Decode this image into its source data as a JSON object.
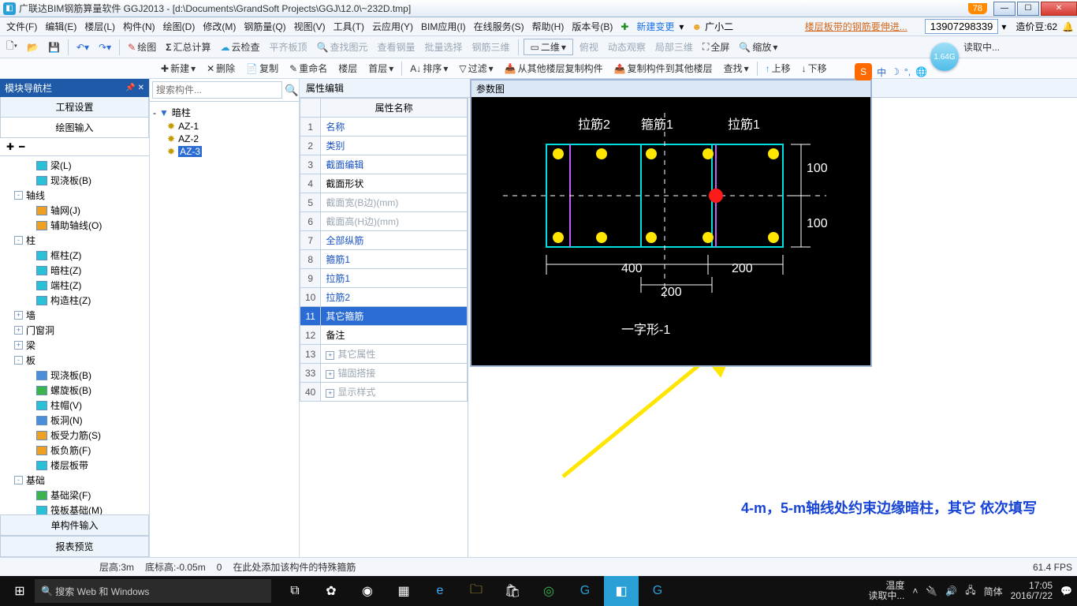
{
  "title": "广联达BIM钢筋算量软件 GGJ2013 - [d:\\Documents\\GrandSoft Projects\\GGJ\\12.0\\~232D.tmp]",
  "badge": "78",
  "menubar": [
    "文件(F)",
    "编辑(E)",
    "楼层(L)",
    "构件(N)",
    "绘图(D)",
    "修改(M)",
    "钢筋量(Q)",
    "视图(V)",
    "工具(T)",
    "云应用(Y)",
    "BIM应用(I)",
    "在线服务(S)",
    "帮助(H)",
    "版本号(B)"
  ],
  "new_change": "新建变更",
  "user_label": "广小二",
  "news": "楼层板带的钢筋要伸进...",
  "phone": "13907298339",
  "coin_label": "造价豆:62",
  "toolbar1": {
    "draw": "绘图",
    "sum": "汇总计算",
    "cloud": "云检查",
    "flat": "平齐板顶",
    "findg": "查找图元",
    "steel": "查看钢量",
    "batch": "批量选择",
    "rebar3d": "钢筋三维",
    "view2d": "二维",
    "pview": "俯视",
    "dyn": "动态观察",
    "part3d": "局部三维",
    "full": "全屏",
    "zoom": "缩放",
    "read": "读取中..."
  },
  "gbubble": "1.64G",
  "toolbar2": {
    "new": "新建",
    "del": "删除",
    "copy": "复制",
    "rename": "重命名",
    "floor": "楼层",
    "first": "首层",
    "sort": "排序",
    "filter": "过滤",
    "copyfrom": "从其他楼层复制构件",
    "copyto": "复制构件到其他楼层",
    "find": "查找",
    "up": "上移",
    "down": "下移"
  },
  "left_panel": {
    "title": "模块导航栏",
    "tabs": [
      "工程设置",
      "绘图输入"
    ],
    "tree": [
      {
        "lvl": 3,
        "icon": "cyan",
        "label": "梁(L)"
      },
      {
        "lvl": 3,
        "icon": "cyan",
        "label": "现浇板(B)"
      },
      {
        "lvl": 1,
        "exp": "-",
        "label": "轴线"
      },
      {
        "lvl": 3,
        "icon": "orange",
        "label": "轴网(J)"
      },
      {
        "lvl": 3,
        "icon": "orange",
        "label": "辅助轴线(O)"
      },
      {
        "lvl": 1,
        "exp": "-",
        "label": "柱"
      },
      {
        "lvl": 3,
        "icon": "cyan",
        "label": "框柱(Z)"
      },
      {
        "lvl": 3,
        "icon": "cyan",
        "label": "暗柱(Z)"
      },
      {
        "lvl": 3,
        "icon": "cyan",
        "label": "端柱(Z)"
      },
      {
        "lvl": 3,
        "icon": "cyan",
        "label": "构造柱(Z)"
      },
      {
        "lvl": 1,
        "exp": "+",
        "label": "墙"
      },
      {
        "lvl": 1,
        "exp": "+",
        "label": "门窗洞"
      },
      {
        "lvl": 1,
        "exp": "+",
        "label": "梁"
      },
      {
        "lvl": 1,
        "exp": "-",
        "label": "板"
      },
      {
        "lvl": 3,
        "icon": "blue",
        "label": "现浇板(B)"
      },
      {
        "lvl": 3,
        "icon": "green",
        "label": "螺旋板(B)"
      },
      {
        "lvl": 3,
        "icon": "cyan",
        "label": "柱帽(V)"
      },
      {
        "lvl": 3,
        "icon": "blue",
        "label": "板洞(N)"
      },
      {
        "lvl": 3,
        "icon": "orange",
        "label": "板受力筋(S)"
      },
      {
        "lvl": 3,
        "icon": "orange",
        "label": "板负筋(F)"
      },
      {
        "lvl": 3,
        "icon": "cyan",
        "label": "楼层板带"
      },
      {
        "lvl": 1,
        "exp": "-",
        "label": "基础"
      },
      {
        "lvl": 3,
        "icon": "green",
        "label": "基础梁(F)"
      },
      {
        "lvl": 3,
        "icon": "cyan",
        "label": "筏板基础(M)"
      },
      {
        "lvl": 3,
        "icon": "blue",
        "label": "集水坑(K)"
      },
      {
        "lvl": 3,
        "icon": "cyan",
        "label": "柱墩(Y)"
      },
      {
        "lvl": 3,
        "icon": "orange",
        "label": "筏板主筋(R)"
      },
      {
        "lvl": 3,
        "icon": "orange",
        "label": "筏板负筋(X)"
      },
      {
        "lvl": 3,
        "icon": "purple",
        "label": "独立基础(P)"
      },
      {
        "lvl": 3,
        "icon": "green",
        "label": "条形基础(T)"
      }
    ],
    "bottom_tabs": [
      "单构件输入",
      "报表预览"
    ]
  },
  "search_placeholder": "搜索构件...",
  "ctree": [
    {
      "lvl": 0,
      "exp": "-",
      "label": "暗柱",
      "root": true
    },
    {
      "lvl": 1,
      "gear": true,
      "label": "AZ-1"
    },
    {
      "lvl": 1,
      "gear": true,
      "label": "AZ-2"
    },
    {
      "lvl": 1,
      "gear": true,
      "label": "AZ-3",
      "sel": true
    }
  ],
  "prop_title": "属性编辑",
  "prop_header": "属性名称",
  "prop_rows": [
    {
      "n": "1",
      "t": "名称",
      "c": "blue"
    },
    {
      "n": "2",
      "t": "类别",
      "c": "blue"
    },
    {
      "n": "3",
      "t": "截面编辑",
      "c": "blue"
    },
    {
      "n": "4",
      "t": "截面形状"
    },
    {
      "n": "5",
      "t": "截面宽(B边)(mm)",
      "c": "grey"
    },
    {
      "n": "6",
      "t": "截面高(H边)(mm)",
      "c": "grey"
    },
    {
      "n": "7",
      "t": "全部纵筋",
      "c": "blue"
    },
    {
      "n": "8",
      "t": "箍筋1",
      "c": "blue"
    },
    {
      "n": "9",
      "t": "拉筋1",
      "c": "blue"
    },
    {
      "n": "10",
      "t": "拉筋2",
      "c": "blue"
    },
    {
      "n": "11",
      "t": "其它箍筋",
      "sel": true
    },
    {
      "n": "12",
      "t": "备注"
    },
    {
      "n": "13",
      "t": "其它属性",
      "c": "grey",
      "pm": "+"
    },
    {
      "n": "33",
      "t": "锚固搭接",
      "c": "grey",
      "pm": "+"
    },
    {
      "n": "40",
      "t": "显示样式",
      "c": "grey",
      "pm": "+"
    }
  ],
  "diagram": {
    "title": "参数图",
    "labels": {
      "l2": "拉筋2",
      "g1": "箍筋1",
      "l1": "拉筋1",
      "d100a": "100",
      "d100b": "100",
      "d400": "400",
      "d200a": "200",
      "d200b": "200",
      "name": "一字形-1"
    }
  },
  "annotation": "4-m，5-m轴线处约束边缘暗柱，其它 依次填写",
  "status": {
    "floor": "层高:3m",
    "base": "底标高:-0.05m",
    "o": "0",
    "hint": "在此处添加该构件的特殊箍筋",
    "fps": "61.4 FPS"
  },
  "taskbar": {
    "search": "搜索 Web 和 Windows",
    "temp_l": "温度",
    "read_l": "读取中...",
    "ime": "简体",
    "time": "17:05",
    "date": "2016/7/22"
  }
}
